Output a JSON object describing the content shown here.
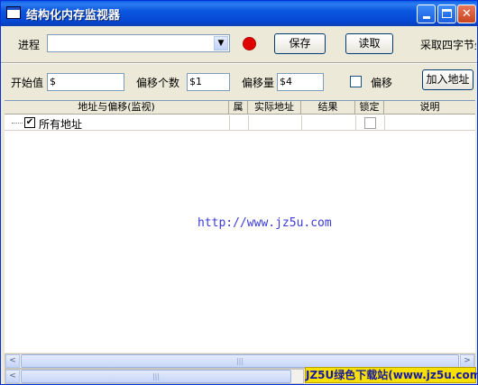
{
  "window": {
    "title": "结构化内存监视器",
    "minimize_icon": "minimize-icon",
    "maximize_icon": "maximize-icon",
    "close_symbol": "✕"
  },
  "toolbar": {
    "process_label": "进程",
    "process_value": "",
    "dropdown_arrow": "▼",
    "record_color": "#e00000",
    "save_label": "保存",
    "read_label": "读取",
    "capture_label": "采取四字节坐"
  },
  "params": {
    "start_label": "开始值",
    "start_value": "$",
    "offset_count_label": "偏移个数",
    "offset_count_value": "$1",
    "offset_amount_label": "偏移量",
    "offset_amount_value": "$4",
    "offset_check_label": "偏移",
    "add_address_label": "加入地址"
  },
  "grid": {
    "columns": [
      "地址与偏移(监视)",
      "属",
      "实际地址",
      "结果",
      "锁定",
      "说明"
    ],
    "rows": [
      {
        "checked": true,
        "check_glyph": "✔",
        "name": "所有地址"
      }
    ]
  },
  "content": {
    "url_text": "http://www.jz5u.com"
  },
  "scrollbars": {
    "left_arrow": "<",
    "right_arrow": ">",
    "grip": "|||"
  },
  "watermark": {
    "text": "JZ5U绿色下载站(www.jz5u.com)"
  }
}
